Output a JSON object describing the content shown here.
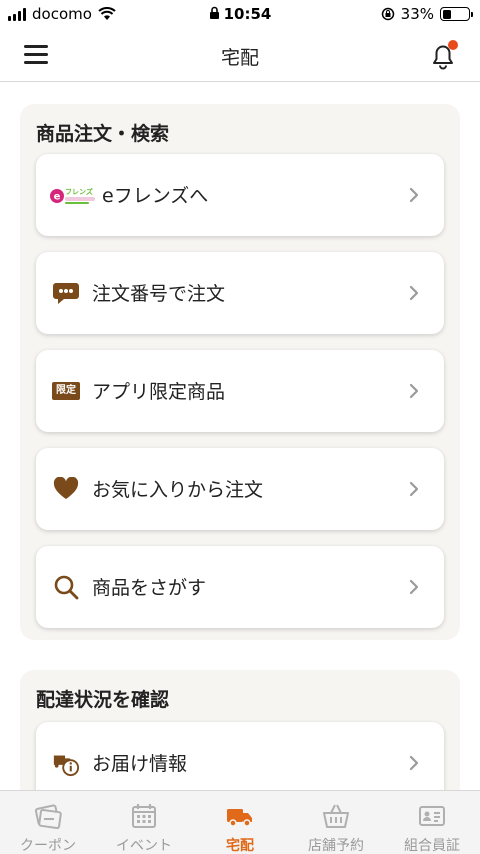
{
  "status_bar": {
    "carrier": "docomo",
    "time": "10:54",
    "battery": "33%",
    "battery_level": 0.33
  },
  "header": {
    "title": "宅配",
    "notification_badge": true
  },
  "colors": {
    "accent": "#e06a1a",
    "icon_brown": "#7a4a1a",
    "badge": "#e84a1c",
    "section_bg": "#f7f5f2"
  },
  "order_section": {
    "title": "商品注文・検索",
    "items": [
      {
        "label": "eフレンズへ",
        "icon": "efriends-logo"
      },
      {
        "label": "注文番号で注文",
        "icon": "chat-bubble-icon"
      },
      {
        "label": "アプリ限定商品",
        "icon": "limited-badge-icon",
        "badge_text": "限定"
      },
      {
        "label": "お気に入りから注文",
        "icon": "heart-icon"
      },
      {
        "label": "商品をさがす",
        "icon": "search-icon"
      }
    ]
  },
  "delivery_section": {
    "title": "配達状況を確認",
    "items": [
      {
        "label": "お届け情報",
        "icon": "delivery-info-icon"
      }
    ]
  },
  "tabs": [
    {
      "label": "クーポン",
      "icon": "coupon-icon",
      "active": false
    },
    {
      "label": "イベント",
      "icon": "calendar-icon",
      "active": false
    },
    {
      "label": "宅配",
      "icon": "truck-icon",
      "active": true
    },
    {
      "label": "店舗予約",
      "icon": "basket-icon",
      "active": false
    },
    {
      "label": "組合員証",
      "icon": "member-card-icon",
      "active": false
    }
  ]
}
